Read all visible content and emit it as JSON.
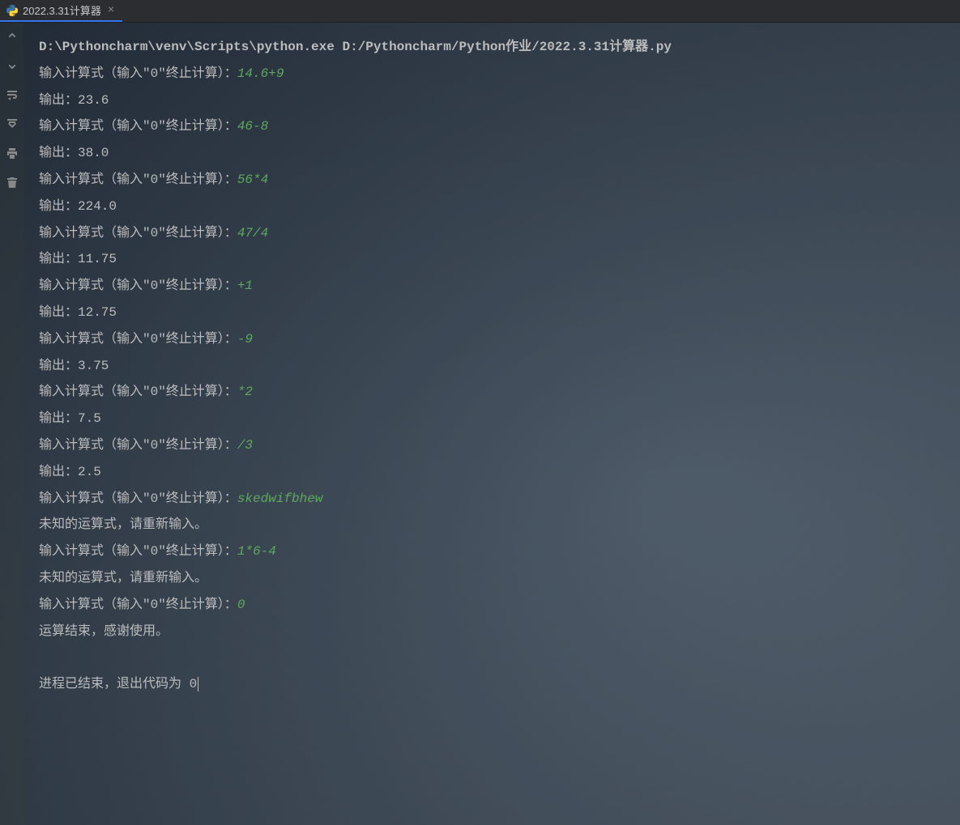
{
  "tab": {
    "title": "2022.3.31计算器",
    "close": "×"
  },
  "console": {
    "cmd": "D:\\Pythoncharm\\venv\\Scripts\\python.exe D:/Pythoncharm/Python作业/2022.3.31计算器.py",
    "prompt_label": "输入计算式（输入\"0\"终止计算）：",
    "output_label": "输出：",
    "unknown_msg": "未知的运算式，请重新输入。",
    "end_msg": "运算结束，感谢使用。",
    "exit_msg_prefix": "进程已结束，退出代码为 ",
    "exit_code": "0",
    "entries": [
      {
        "input": "14.6+9",
        "output": "23.6"
      },
      {
        "input": "46-8",
        "output": "38.0"
      },
      {
        "input": "56*4",
        "output": "224.0"
      },
      {
        "input": "47/4",
        "output": "11.75"
      },
      {
        "input": "+1",
        "output": "12.75"
      },
      {
        "input": "-9",
        "output": "3.75"
      },
      {
        "input": "*2",
        "output": "7.5"
      },
      {
        "input": "/3",
        "output": "2.5"
      },
      {
        "input": "skedwifbhew",
        "error": true
      },
      {
        "input": "1*6-4",
        "error": true
      },
      {
        "input": "0",
        "terminate": true
      }
    ]
  }
}
